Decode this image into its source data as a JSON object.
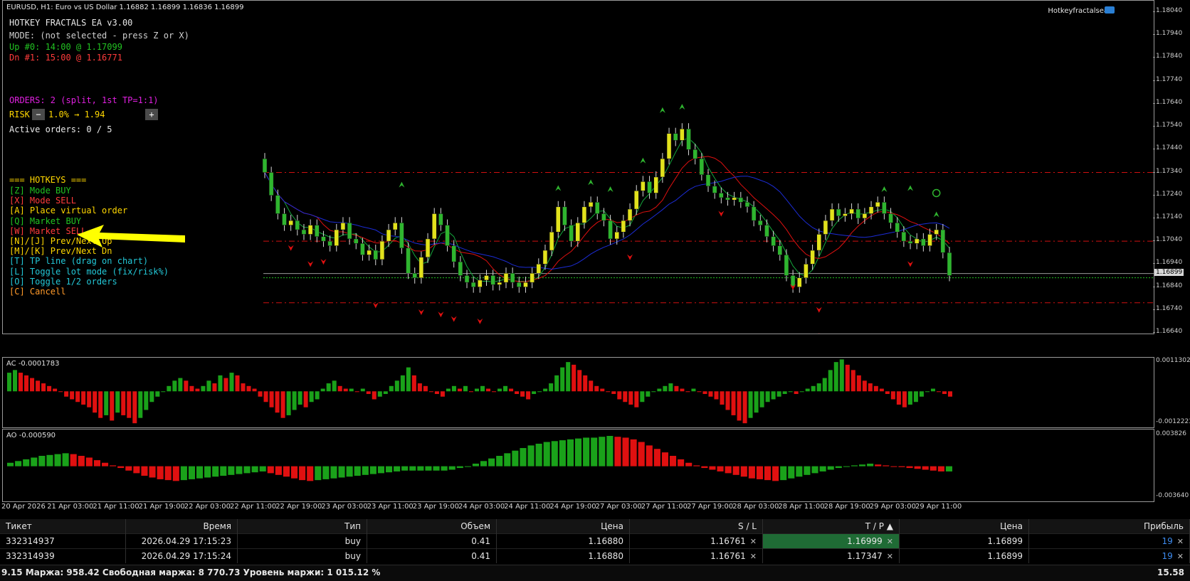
{
  "window": {
    "symbol_info": "EURUSD, H1:  Euro vs US Dollar  1.16882 1.16899 1.16836 1.16899",
    "indicator_name": "Hotkeyfractalsea"
  },
  "panel": {
    "title": "HOTKEY FRACTALS EA v3.00",
    "mode": "MODE: (not selected - press Z or X)",
    "up_fractal": "Up #0: 14:00 @ 1.17099",
    "dn_fractal": "Dn #1: 15:00 @ 1.16771",
    "orders": "ORDERS: 2 (split, 1st TP=1:1)",
    "risk_label": "RISK",
    "risk_minus": "−",
    "risk_value": "1.0% → 1.94",
    "risk_plus": "+",
    "active_orders": "Active orders: 0 / 5",
    "hotkeys_header": "=== HOTKEYS ===",
    "hotkeys": [
      {
        "text": "[Z] Mode BUY",
        "color": "#22c322"
      },
      {
        "text": "[X] Mode SELL",
        "color": "#ff3b3b"
      },
      {
        "text": "[A] Place virtual order",
        "color": "#ffd700"
      },
      {
        "text": "[Q] Market BUY",
        "color": "#22c322"
      },
      {
        "text": "[W] Market SELL",
        "color": "#ff3b3b"
      },
      {
        "text": "[N]/[J] Prev/Next Up",
        "color": "#ffd700"
      },
      {
        "text": "[M]/[K] Prev/Next Dn",
        "color": "#ffd700"
      },
      {
        "text": "[T] TP line (drag on chart)",
        "color": "#23c8d8"
      },
      {
        "text": "[L] Toggle lot mode (fix/risk%)",
        "color": "#23c8d8"
      },
      {
        "text": "[O] Toggle 1/2 orders",
        "color": "#23c8d8"
      },
      {
        "text": "[C] Cancell",
        "color": "#ff9a2a"
      }
    ]
  },
  "price_scale": {
    "labels": [
      "1.18040",
      "1.17940",
      "1.17840",
      "1.17740",
      "1.17640",
      "1.17540",
      "1.17440",
      "1.17340",
      "1.17240",
      "1.17140",
      "1.17040",
      "1.16940",
      "1.16840",
      "1.16740",
      "1.16640"
    ],
    "current": "1.16899"
  },
  "ac": {
    "label": "AC -0.0001783",
    "scale_top": "0.0011302",
    "scale_bottom": "-0.0012223",
    "values": [
      0.0007,
      0.0008,
      0.0007,
      0.0006,
      0.0005,
      0.0004,
      0.0003,
      0.0002,
      0.0001,
      0.0,
      -0.0002,
      -0.0003,
      -0.0004,
      -0.0005,
      -0.0006,
      -0.0008,
      -0.001,
      -0.0009,
      -0.0011,
      -0.0008,
      -0.0009,
      -0.001,
      -0.0012,
      -0.001,
      -0.0007,
      -0.0004,
      -0.0002,
      0.0,
      0.0002,
      0.0004,
      0.0005,
      0.0004,
      0.0002,
      0.0001,
      0.0002,
      0.0004,
      0.0003,
      0.0006,
      0.0005,
      0.0007,
      0.0006,
      0.0003,
      0.0002,
      0.0001,
      -0.0002,
      -0.0004,
      -0.0006,
      -0.0008,
      -0.001,
      -0.0009,
      -0.0007,
      -0.0005,
      -0.0006,
      -0.0004,
      -0.0003,
      0.0001,
      0.0003,
      0.0004,
      0.0002,
      0.0001,
      0.0001,
      0.0,
      0.0001,
      -0.0001,
      -0.0003,
      -0.0002,
      -0.0001,
      0.0002,
      0.0004,
      0.0006,
      0.0009,
      0.0006,
      0.0003,
      0.0002,
      0.0,
      -0.0001,
      -0.0002,
      0.0001,
      0.0002,
      0.0001,
      0.0002,
      0.0,
      0.0001,
      0.0002,
      0.0001,
      0.0,
      0.0001,
      0.0002,
      0.0001,
      -0.0001,
      -0.0002,
      -0.0003,
      -0.0001,
      0.0,
      0.0001,
      0.0003,
      0.0006,
      0.0009,
      0.0011,
      0.001,
      0.0008,
      0.0006,
      0.0004,
      0.0002,
      0.0001,
      0.0,
      -0.0001,
      -0.0003,
      -0.0004,
      -0.0005,
      -0.0006,
      -0.0004,
      -0.0002,
      0.0,
      0.0001,
      0.0002,
      0.0003,
      0.0002,
      0.0001,
      0.0,
      0.0001,
      0.0,
      -0.0001,
      -0.0002,
      -0.0003,
      -0.0005,
      -0.0007,
      -0.0009,
      -0.0011,
      -0.0012,
      -0.001,
      -0.0008,
      -0.0006,
      -0.0004,
      -0.0003,
      -0.0002,
      -0.0001,
      0.0,
      -0.0001,
      0.0,
      0.0001,
      0.0002,
      0.0003,
      0.0005,
      0.0008,
      0.0011,
      0.0012,
      0.001,
      0.0008,
      0.0006,
      0.0004,
      0.0003,
      0.0002,
      0.0001,
      -0.0001,
      -0.0003,
      -0.0005,
      -0.0006,
      -0.0005,
      -0.0004,
      -0.0002,
      0.0,
      0.0001,
      0.0,
      -0.0001,
      -0.0002
    ]
  },
  "ao": {
    "label": "AO -0.000590",
    "scale_top": "0.003826",
    "scale_bottom": "-0.003640",
    "values": [
      0.0004,
      0.0006,
      0.0008,
      0.001,
      0.0012,
      0.0013,
      0.0014,
      0.0015,
      0.0014,
      0.0012,
      0.001,
      0.0007,
      0.0004,
      0.0001,
      -0.0002,
      -0.0005,
      -0.0008,
      -0.0011,
      -0.0013,
      -0.0015,
      -0.0016,
      -0.0017,
      -0.0016,
      -0.0015,
      -0.0014,
      -0.0013,
      -0.0012,
      -0.0011,
      -0.001,
      -0.0009,
      -0.0008,
      -0.0007,
      -0.0006,
      -0.0008,
      -0.001,
      -0.0012,
      -0.0014,
      -0.0016,
      -0.0017,
      -0.0016,
      -0.0015,
      -0.0014,
      -0.0013,
      -0.0012,
      -0.0011,
      -0.001,
      -0.0009,
      -0.0008,
      -0.0007,
      -0.0006,
      -0.0005,
      -0.0005,
      -0.0005,
      -0.0005,
      -0.0005,
      -0.0005,
      -0.0004,
      -0.0002,
      0.0,
      0.0003,
      0.0006,
      0.0009,
      0.0012,
      0.0015,
      0.0018,
      0.0021,
      0.0024,
      0.0026,
      0.0028,
      0.0029,
      0.003,
      0.0031,
      0.0032,
      0.0033,
      0.0033,
      0.0034,
      0.0035,
      0.0034,
      0.0033,
      0.0031,
      0.0028,
      0.0024,
      0.002,
      0.0016,
      0.0012,
      0.0008,
      0.0004,
      0.0001,
      -0.0002,
      -0.0004,
      -0.0006,
      -0.0008,
      -0.001,
      -0.0012,
      -0.0014,
      -0.0015,
      -0.0016,
      -0.0017,
      -0.0016,
      -0.0014,
      -0.0012,
      -0.001,
      -0.0008,
      -0.0006,
      -0.0004,
      -0.0002,
      0.0,
      0.0001,
      0.0002,
      0.0003,
      0.0002,
      0.0001,
      0.0,
      -0.0001,
      -0.0002,
      -0.0003,
      -0.0004,
      -0.0005,
      -0.0006,
      -0.0006
    ]
  },
  "time_axis": [
    "20 Apr 2026",
    "21 Apr 03:00",
    "21 Apr 11:00",
    "21 Apr 19:00",
    "22 Apr 03:00",
    "22 Apr 11:00",
    "22 Apr 19:00",
    "23 Apr 03:00",
    "23 Apr 11:00",
    "23 Apr 19:00",
    "24 Apr 03:00",
    "24 Apr 11:00",
    "24 Apr 19:00",
    "27 Apr 03:00",
    "27 Apr 11:00",
    "27 Apr 19:00",
    "28 Apr 03:00",
    "28 Apr 11:00",
    "28 Apr 19:00",
    "29 Apr 03:00",
    "29 Apr 11:00"
  ],
  "price_series": [
    1.1734,
    1.1724,
    1.1716,
    1.1711,
    1.1713,
    1.1709,
    1.1707,
    1.1711,
    1.1706,
    1.1704,
    1.1702,
    1.1709,
    1.1712,
    1.1705,
    1.1703,
    1.1698,
    1.17,
    1.1696,
    1.1704,
    1.1709,
    1.1712,
    1.1701,
    1.169,
    1.1688,
    1.1697,
    1.1705,
    1.1716,
    1.1711,
    1.1702,
    1.1695,
    1.1689,
    1.1686,
    1.1684,
    1.1687,
    1.1689,
    1.1685,
    1.1686,
    1.169,
    1.1686,
    1.1684,
    1.1686,
    1.169,
    1.1694,
    1.17,
    1.1708,
    1.1719,
    1.1711,
    1.1704,
    1.1712,
    1.1719,
    1.1721,
    1.1716,
    1.1713,
    1.1705,
    1.1708,
    1.1713,
    1.1718,
    1.1726,
    1.173,
    1.1725,
    1.1732,
    1.174,
    1.1751,
    1.1748,
    1.1753,
    1.1744,
    1.174,
    1.1733,
    1.1728,
    1.1725,
    1.1723,
    1.1722,
    1.1723,
    1.1721,
    1.1719,
    1.1713,
    1.1711,
    1.1706,
    1.1702,
    1.1698,
    1.1689,
    1.1684,
    1.1688,
    1.1694,
    1.17,
    1.1707,
    1.1713,
    1.1718,
    1.1715,
    1.1716,
    1.1718,
    1.1714,
    1.1716,
    1.1719,
    1.1721,
    1.1716,
    1.1712,
    1.1708,
    1.1704,
    1.1703,
    1.1705,
    1.1702,
    1.1707,
    1.1709,
    1.1699,
    1.1689
  ],
  "levels": {
    "red_dashed": [
      1.1734,
      1.1704,
      1.16771
    ],
    "green_dotted": 1.1688,
    "white_line": 1.16899
  },
  "orders_table": {
    "headers": [
      "Тикет",
      "Время",
      "Тип",
      "Объем",
      "Цена",
      "S / L",
      "T / P  ▲",
      "Цена",
      "Прибыль"
    ],
    "rows": [
      [
        "332314937",
        "2026.04.29 17:15:23",
        "buy",
        "0.41",
        "1.16880",
        "1.16761",
        "1.16999",
        "1.16899",
        "19"
      ],
      [
        "332314939",
        "2026.04.29 17:15:24",
        "buy",
        "0.41",
        "1.16880",
        "1.16761",
        "1.17347",
        "1.16899",
        "19"
      ]
    ],
    "close_mark": "✕"
  },
  "status": {
    "left": "9.15  Маржа: 958.42  Свободная маржа: 8 770.73  Уровень маржи: 1 015.12 %",
    "right": "15.58"
  },
  "colors": {
    "bull": "#e2e21c",
    "bear": "#2fb52f",
    "ma_blue": "#1c2cd6",
    "ma_red": "#e01010",
    "ma_green": "#14a83c",
    "hist_up": "#1aa21a",
    "hist_dn": "#e01010",
    "arrow_yellow": "#ffff00"
  }
}
